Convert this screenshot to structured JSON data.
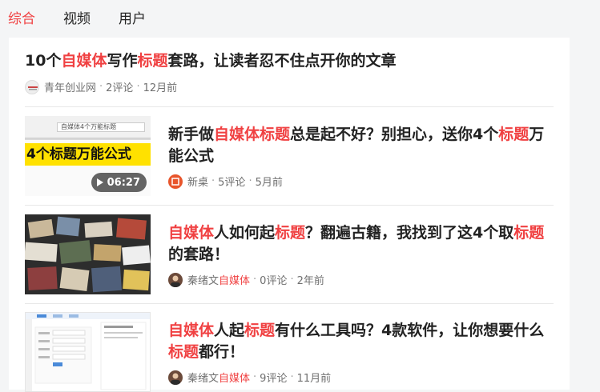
{
  "tabs": [
    {
      "label": "综合",
      "active": true
    },
    {
      "label": "视频",
      "active": false
    },
    {
      "label": "用户",
      "active": false
    }
  ],
  "accent_color": "#f04142",
  "articles": [
    {
      "title_parts": [
        {
          "text": "10个",
          "hl": false
        },
        {
          "text": "自媒体",
          "hl": true
        },
        {
          "text": "写作",
          "hl": false
        },
        {
          "text": "标题",
          "hl": true
        },
        {
          "text": "套路，让读者忍不住点开你的文章",
          "hl": false
        }
      ],
      "author_parts": [
        {
          "text": "青年创业网",
          "hl": false
        }
      ],
      "comments": "2评论",
      "time": "12月前"
    },
    {
      "title_parts": [
        {
          "text": "新手做",
          "hl": false
        },
        {
          "text": "自媒体标题",
          "hl": true
        },
        {
          "text": "总是起不好？别担心，送你4个",
          "hl": false
        },
        {
          "text": "标题",
          "hl": true
        },
        {
          "text": "万能公式",
          "hl": false
        }
      ],
      "thumb_text": "4个标题万能公式",
      "thumb_subtitle": "自媒体4个万能标题",
      "video_duration": "06:27",
      "author_parts": [
        {
          "text": "新桌",
          "hl": false
        }
      ],
      "comments": "5评论",
      "time": "5月前"
    },
    {
      "title_parts": [
        {
          "text": "自媒体",
          "hl": true
        },
        {
          "text": "人如何起",
          "hl": false
        },
        {
          "text": "标题",
          "hl": true
        },
        {
          "text": "？翻遍古籍，我找到了这4个取",
          "hl": false
        },
        {
          "text": "标题",
          "hl": true
        },
        {
          "text": "的套路！",
          "hl": false
        }
      ],
      "author_parts": [
        {
          "text": "秦绪文",
          "hl": false
        },
        {
          "text": "自媒体",
          "hl": true
        }
      ],
      "comments": "0评论",
      "time": "2年前"
    },
    {
      "title_parts": [
        {
          "text": "自媒体",
          "hl": true
        },
        {
          "text": "人起",
          "hl": false
        },
        {
          "text": "标题",
          "hl": true
        },
        {
          "text": "有什么工具吗？4款软件，让你想要什么",
          "hl": false
        },
        {
          "text": "标题",
          "hl": true
        },
        {
          "text": "都行！",
          "hl": false
        }
      ],
      "author_parts": [
        {
          "text": "秦绪文",
          "hl": false
        },
        {
          "text": "自媒体",
          "hl": true
        }
      ],
      "comments": "9评论",
      "time": "11月前"
    }
  ]
}
